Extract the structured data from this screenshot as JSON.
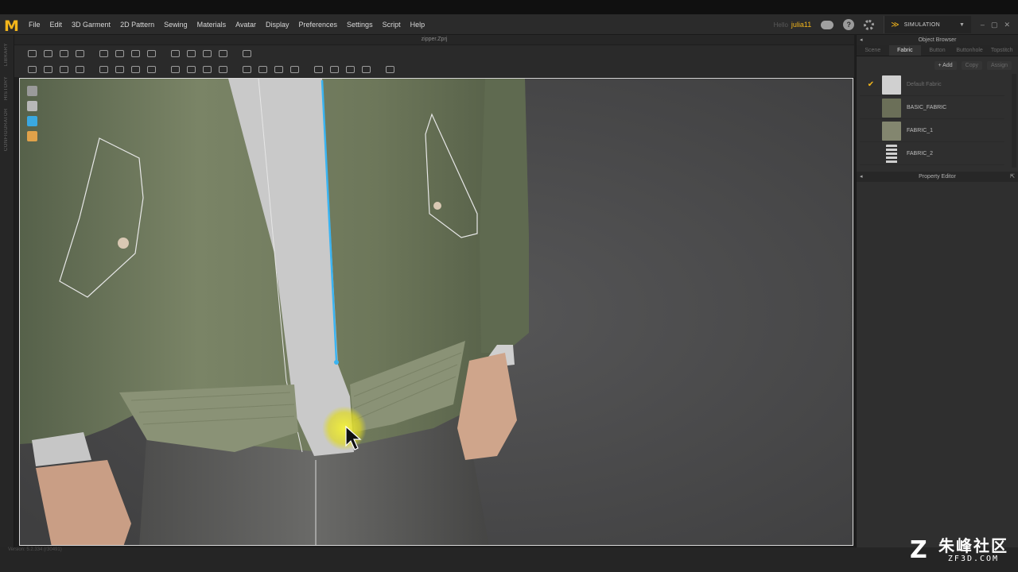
{
  "app": {
    "logo": "M",
    "document_title": "zipper.Zprj"
  },
  "menu": [
    "File",
    "Edit",
    "3D Garment",
    "2D Pattern",
    "Sewing",
    "Materials",
    "Avatar",
    "Display",
    "Preferences",
    "Settings",
    "Script",
    "Help"
  ],
  "user": {
    "prefix": "Hello",
    "name": "julia11"
  },
  "mode": {
    "label": "SIMULATION"
  },
  "left_tabs": [
    "LIBRARY",
    "HISTORY",
    "CONFIGURATOR"
  ],
  "object_browser": {
    "title": "Object Browser",
    "tabs": [
      "Scene",
      "Fabric",
      "Button",
      "Buttonhole",
      "Topstitch"
    ],
    "active_tab": "Fabric",
    "actions": [
      "+ Add",
      "Copy",
      "Assign"
    ],
    "fabrics": [
      {
        "name": "Default Fabric",
        "checked": true,
        "dim": true,
        "color": "#d0d0d0"
      },
      {
        "name": "BASIC_FABRIC",
        "checked": false,
        "dim": false,
        "color": "#6b6f58"
      },
      {
        "name": "FABRIC_1",
        "checked": false,
        "dim": false,
        "color": "#83866f"
      },
      {
        "name": "FABRIC_2",
        "checked": false,
        "dim": false,
        "color": "zipper"
      }
    ]
  },
  "property_editor": {
    "title": "Property Editor"
  },
  "status": {
    "text": "Version: 5.2.334  (r30491)"
  },
  "watermark": {
    "chinese": "朱峰社区",
    "url": "ZF3D.COM"
  },
  "colors": {
    "accent": "#f2b51b",
    "jacket": "#6b7558",
    "selection": "#3ab4f2"
  }
}
